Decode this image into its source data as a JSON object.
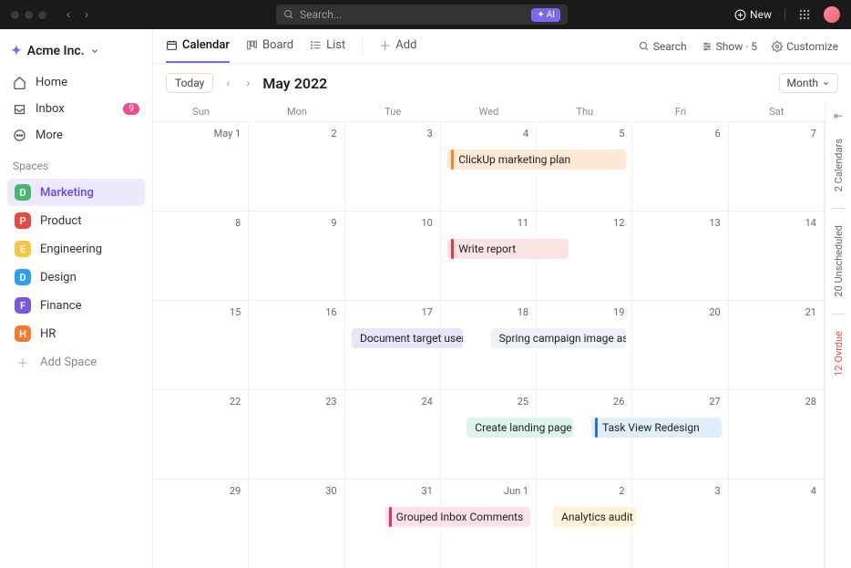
{
  "titlebar": {
    "search_placeholder": "Search...",
    "ai_label": "AI",
    "new_label": "New"
  },
  "workspace": {
    "name": "Acme Inc."
  },
  "nav": {
    "home": "Home",
    "inbox": "Inbox",
    "inbox_badge": "9",
    "more": "More"
  },
  "spaces_header": "Spaces",
  "spaces": [
    {
      "letter": "D",
      "label": "Marketing",
      "color": "#49b66e",
      "active": true
    },
    {
      "letter": "P",
      "label": "Product",
      "color": "#e8493f"
    },
    {
      "letter": "E",
      "label": "Engineering",
      "color": "#f7c744"
    },
    {
      "letter": "D",
      "label": "Design",
      "color": "#2e9df4"
    },
    {
      "letter": "F",
      "label": "Finance",
      "color": "#7b57e0"
    },
    {
      "letter": "H",
      "label": "HR",
      "color": "#f57a2b"
    }
  ],
  "add_space": "Add Space",
  "tabs": {
    "calendar": "Calendar",
    "board": "Board",
    "list": "List",
    "add": "Add",
    "search": "Search",
    "show": "Show · 5",
    "customize": "Customize"
  },
  "calendar": {
    "today": "Today",
    "title": "May 2022",
    "mode": "Month",
    "dow": [
      "Sun",
      "Mon",
      "Tue",
      "Wed",
      "Thu",
      "Fri",
      "Sat"
    ],
    "weeks": [
      [
        "May 1",
        "2",
        "3",
        "4",
        "5",
        "6",
        "7"
      ],
      [
        "8",
        "9",
        "10",
        "11",
        "12",
        "13",
        "14"
      ],
      [
        "15",
        "16",
        "17",
        "18",
        "19",
        "20",
        "21"
      ],
      [
        "22",
        "23",
        "24",
        "25",
        "26",
        "27",
        "28"
      ],
      [
        "29",
        "30",
        "31",
        "Jun 1",
        "2",
        "3",
        "4"
      ]
    ],
    "events": [
      {
        "week": 0,
        "start": 3,
        "span": 2,
        "label": "ClickUp marketing plan",
        "bg": "#fde9d6",
        "bar": "#f5861f"
      },
      {
        "week": 1,
        "start": 3,
        "span": 1.4,
        "label": "Write report",
        "bg": "#fce3e3",
        "bar": "#e23b3b"
      },
      {
        "week": 2,
        "start": 2,
        "span": 1.3,
        "label": "Document target users",
        "bg": "#e7e4fb",
        "bar": "#5f48e9"
      },
      {
        "week": 2,
        "start": 3.45,
        "span": 1.55,
        "label": "Spring campaign image assets",
        "bg": "#eef1f6",
        "bar": "#3a5aa8"
      },
      {
        "week": 3,
        "start": 3.2,
        "span": 1.25,
        "label": "Create landing page",
        "bg": "#def4ee",
        "bar": "#2fb58f"
      },
      {
        "week": 3,
        "start": 4.5,
        "span": 1.5,
        "label": "Task View Redesign",
        "bg": "#e3eefb",
        "bar": "#2d6fd6"
      },
      {
        "week": 4,
        "start": 2.35,
        "span": 1.65,
        "label": "Grouped Inbox Comments",
        "bg": "#fde2ea",
        "bar": "#e22f70"
      },
      {
        "week": 4,
        "start": 4.1,
        "span": 1.0,
        "label": "Analytics audit",
        "bg": "#fdf3d9",
        "bar": "#f0a816"
      }
    ]
  },
  "rail": {
    "calendars": "2 Calendars",
    "unscheduled": "20 Unscheduled",
    "overdue": "12 Ovrdue"
  }
}
